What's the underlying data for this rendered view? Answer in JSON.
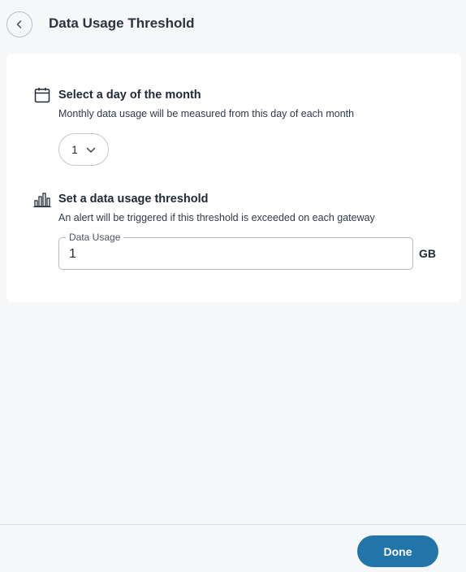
{
  "header": {
    "title": "Data Usage Threshold",
    "back_icon": "chevron-left-icon"
  },
  "day_section": {
    "icon": "calendar-icon",
    "title": "Select a day of the month",
    "description": "Monthly data usage will be measured from this day of each month",
    "selected_day": "1",
    "dropdown_icon": "chevron-down-icon"
  },
  "threshold_section": {
    "icon": "bar-chart-icon",
    "title": "Set a data usage threshold",
    "description": "An alert will be triggered if this threshold is exceeded on each gateway",
    "field_label": "Data Usage",
    "field_value": "1",
    "unit": "GB"
  },
  "footer": {
    "done_label": "Done"
  },
  "colors": {
    "primary": "#2275a8",
    "background": "#f6f7f9",
    "card": "#ffffff"
  }
}
